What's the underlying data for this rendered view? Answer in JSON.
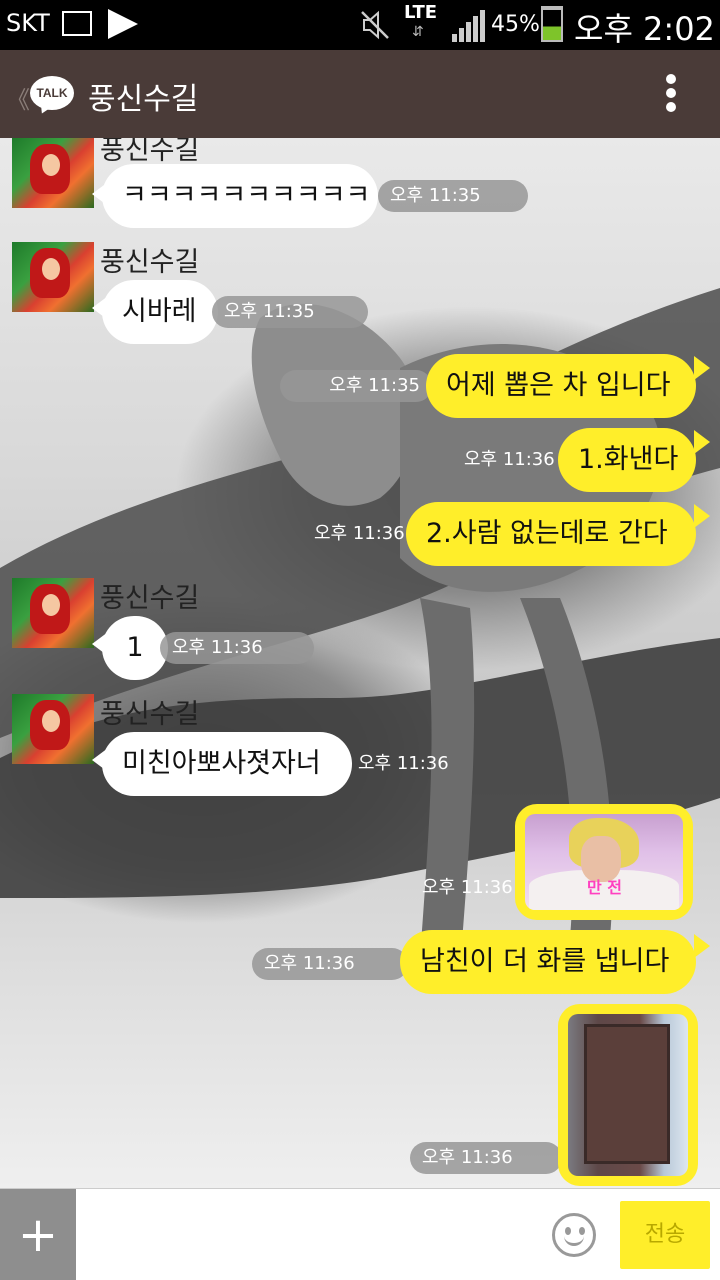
{
  "status_bar": {
    "carrier": "SKT",
    "network": "LTE",
    "network_arrows": "⇵",
    "battery": "45%",
    "time": "오후 2:02"
  },
  "header": {
    "back": "《",
    "logo_text": "TALK",
    "title": "풍신수길"
  },
  "messages": {
    "m1": {
      "sender": "풍신수길",
      "text": "ㅋㅋㅋㅋㅋㅋㅋㅋㅋㅋ",
      "time": "오후 11:35"
    },
    "m2": {
      "sender": "풍신수길",
      "text": "시바레",
      "time": "오후 11:35"
    },
    "m3": {
      "text": "어제 뽑은 차 입니다",
      "time": "오후 11:35"
    },
    "m4": {
      "text": "1.화낸다",
      "time": "오후 11:36"
    },
    "m5": {
      "text": "2.사람 없는데로 간다",
      "time": "오후 11:36"
    },
    "m6": {
      "sender": "풍신수길",
      "text": "1",
      "time": "오후 11:36"
    },
    "m7": {
      "sender": "풍신수길",
      "text": "미친아뽀사졋자너",
      "time": "오후 11:36"
    },
    "m8": {
      "caption": "만 전",
      "time": "오후 11:36"
    },
    "m9": {
      "text": "남친이 더 화를 냅니다",
      "time": "오후 11:36"
    },
    "m10": {
      "time": "오후 11:36"
    }
  },
  "input": {
    "plus": "+",
    "send": "전송"
  }
}
